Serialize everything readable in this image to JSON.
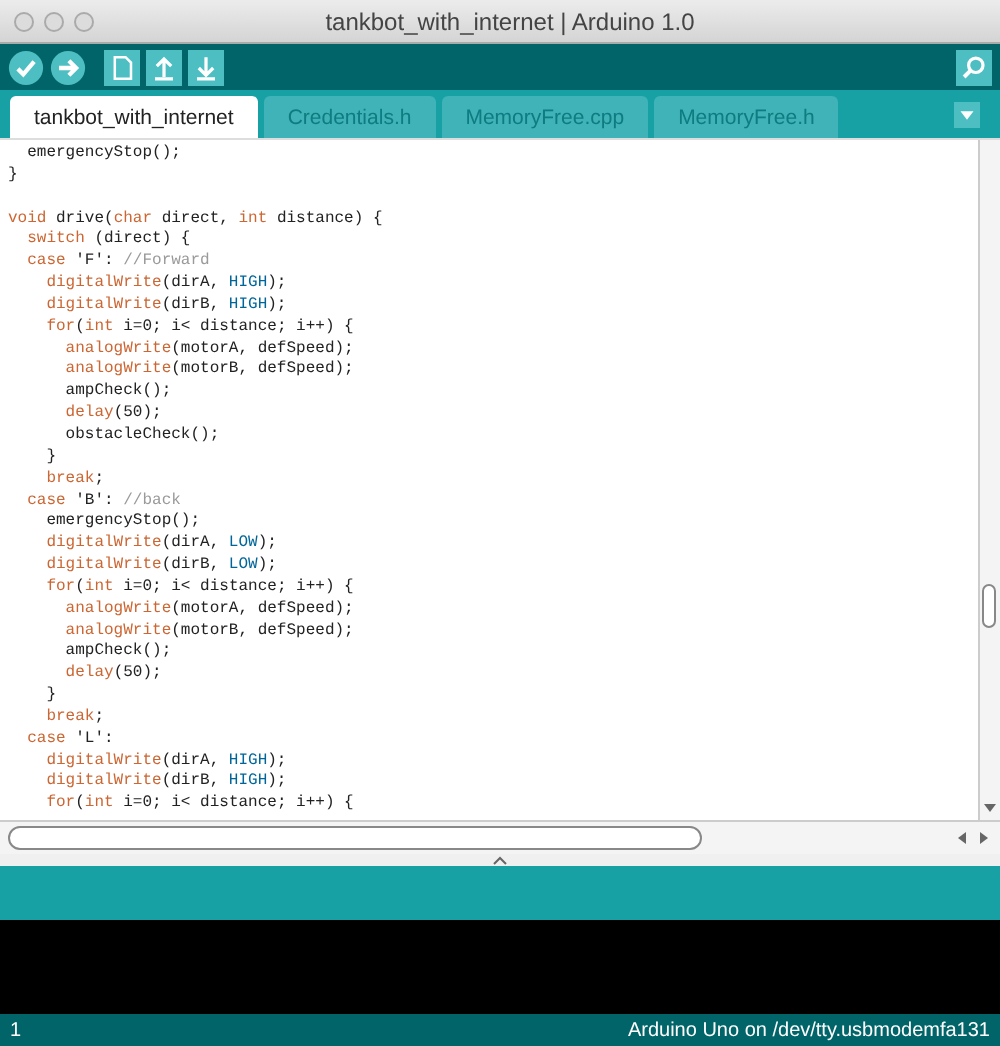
{
  "window": {
    "title": "tankbot_with_internet | Arduino 1.0"
  },
  "tabs": [
    {
      "label": "tankbot_with_internet",
      "selected": true
    },
    {
      "label": "Credentials.h",
      "selected": false
    },
    {
      "label": "MemoryFree.cpp",
      "selected": false
    },
    {
      "label": "MemoryFree.h",
      "selected": false
    }
  ],
  "editor": {
    "lines": [
      {
        "kind": "code",
        "tokens": [
          {
            "text": "  emergencyStop();",
            "kind": "plain"
          }
        ]
      },
      {
        "kind": "code",
        "tokens": [
          {
            "text": "}",
            "kind": "plain"
          }
        ]
      },
      {
        "kind": "blank"
      },
      {
        "kind": "code",
        "tokens": [
          {
            "text": "void",
            "kind": "keyword"
          },
          {
            "text": " drive(",
            "kind": "plain"
          },
          {
            "text": "char",
            "kind": "keyword"
          },
          {
            "text": " direct, ",
            "kind": "plain"
          },
          {
            "text": "int",
            "kind": "keyword"
          },
          {
            "text": " distance) {",
            "kind": "plain"
          }
        ]
      },
      {
        "kind": "code",
        "tokens": [
          {
            "text": "  switch",
            "kind": "keyword"
          },
          {
            "text": " (direct) {",
            "kind": "plain"
          }
        ]
      },
      {
        "kind": "code",
        "tokens": [
          {
            "text": "  case",
            "kind": "keyword"
          },
          {
            "text": " 'F': ",
            "kind": "plain"
          },
          {
            "text": "//Forward",
            "kind": "comment"
          }
        ]
      },
      {
        "kind": "code",
        "tokens": [
          {
            "text": "    digitalWrite",
            "kind": "keyword"
          },
          {
            "text": "(dirA, ",
            "kind": "plain"
          },
          {
            "text": "HIGH",
            "kind": "constant"
          },
          {
            "text": ");",
            "kind": "plain"
          }
        ]
      },
      {
        "kind": "code",
        "tokens": [
          {
            "text": "    digitalWrite",
            "kind": "keyword"
          },
          {
            "text": "(dirB, ",
            "kind": "plain"
          },
          {
            "text": "HIGH",
            "kind": "constant"
          },
          {
            "text": ");",
            "kind": "plain"
          }
        ]
      },
      {
        "kind": "code",
        "tokens": [
          {
            "text": "    for",
            "kind": "keyword"
          },
          {
            "text": "(",
            "kind": "plain"
          },
          {
            "text": "int",
            "kind": "keyword"
          },
          {
            "text": " i=0; i< distance; i++) {",
            "kind": "plain"
          }
        ]
      },
      {
        "kind": "code",
        "tokens": [
          {
            "text": "      analogWrite",
            "kind": "keyword"
          },
          {
            "text": "(motorA, defSpeed);",
            "kind": "plain"
          }
        ]
      },
      {
        "kind": "code",
        "tokens": [
          {
            "text": "      analogWrite",
            "kind": "keyword"
          },
          {
            "text": "(motorB, defSpeed);",
            "kind": "plain"
          }
        ]
      },
      {
        "kind": "code",
        "tokens": [
          {
            "text": "      ampCheck();",
            "kind": "plain"
          }
        ]
      },
      {
        "kind": "code",
        "tokens": [
          {
            "text": "      delay",
            "kind": "keyword"
          },
          {
            "text": "(50);",
            "kind": "plain"
          }
        ]
      },
      {
        "kind": "code",
        "tokens": [
          {
            "text": "      obstacleCheck();",
            "kind": "plain"
          }
        ]
      },
      {
        "kind": "code",
        "tokens": [
          {
            "text": "    }",
            "kind": "plain"
          }
        ]
      },
      {
        "kind": "code",
        "tokens": [
          {
            "text": "    break",
            "kind": "keyword"
          },
          {
            "text": ";",
            "kind": "plain"
          }
        ]
      },
      {
        "kind": "code",
        "tokens": [
          {
            "text": "  case",
            "kind": "keyword"
          },
          {
            "text": " 'B': ",
            "kind": "plain"
          },
          {
            "text": "//back",
            "kind": "comment"
          }
        ]
      },
      {
        "kind": "code",
        "tokens": [
          {
            "text": "    emergencyStop();",
            "kind": "plain"
          }
        ]
      },
      {
        "kind": "code",
        "tokens": [
          {
            "text": "    digitalWrite",
            "kind": "keyword"
          },
          {
            "text": "(dirA, ",
            "kind": "plain"
          },
          {
            "text": "LOW",
            "kind": "constant"
          },
          {
            "text": ");",
            "kind": "plain"
          }
        ]
      },
      {
        "kind": "code",
        "tokens": [
          {
            "text": "    digitalWrite",
            "kind": "keyword"
          },
          {
            "text": "(dirB, ",
            "kind": "plain"
          },
          {
            "text": "LOW",
            "kind": "constant"
          },
          {
            "text": ");",
            "kind": "plain"
          }
        ]
      },
      {
        "kind": "code",
        "tokens": [
          {
            "text": "    for",
            "kind": "keyword"
          },
          {
            "text": "(",
            "kind": "plain"
          },
          {
            "text": "int",
            "kind": "keyword"
          },
          {
            "text": " i=0; i< distance; i++) {",
            "kind": "plain"
          }
        ]
      },
      {
        "kind": "code",
        "tokens": [
          {
            "text": "      analogWrite",
            "kind": "keyword"
          },
          {
            "text": "(motorA, defSpeed);",
            "kind": "plain"
          }
        ]
      },
      {
        "kind": "code",
        "tokens": [
          {
            "text": "      analogWrite",
            "kind": "keyword"
          },
          {
            "text": "(motorB, defSpeed);",
            "kind": "plain"
          }
        ]
      },
      {
        "kind": "code",
        "tokens": [
          {
            "text": "      ampCheck();",
            "kind": "plain"
          }
        ]
      },
      {
        "kind": "code",
        "tokens": [
          {
            "text": "      delay",
            "kind": "keyword"
          },
          {
            "text": "(50);",
            "kind": "plain"
          }
        ]
      },
      {
        "kind": "code",
        "tokens": [
          {
            "text": "    }",
            "kind": "plain"
          }
        ]
      },
      {
        "kind": "code",
        "tokens": [
          {
            "text": "    break",
            "kind": "keyword"
          },
          {
            "text": ";",
            "kind": "plain"
          }
        ]
      },
      {
        "kind": "code",
        "tokens": [
          {
            "text": "  case",
            "kind": "keyword"
          },
          {
            "text": " 'L':",
            "kind": "plain"
          }
        ]
      },
      {
        "kind": "code",
        "tokens": [
          {
            "text": "    digitalWrite",
            "kind": "keyword"
          },
          {
            "text": "(dirA, ",
            "kind": "plain"
          },
          {
            "text": "HIGH",
            "kind": "constant"
          },
          {
            "text": ");",
            "kind": "plain"
          }
        ]
      },
      {
        "kind": "code",
        "tokens": [
          {
            "text": "    digitalWrite",
            "kind": "keyword"
          },
          {
            "text": "(dirB, ",
            "kind": "plain"
          },
          {
            "text": "HIGH",
            "kind": "constant"
          },
          {
            "text": ");",
            "kind": "plain"
          }
        ]
      },
      {
        "kind": "code",
        "tokens": [
          {
            "text": "    for",
            "kind": "keyword"
          },
          {
            "text": "(",
            "kind": "plain"
          },
          {
            "text": "int",
            "kind": "keyword"
          },
          {
            "text": " i=0; i< distance; i++) {",
            "kind": "plain"
          }
        ]
      }
    ]
  },
  "status_bar": {
    "line": "1",
    "board": "Arduino Uno on /dev/tty.usbmodemfa131"
  }
}
